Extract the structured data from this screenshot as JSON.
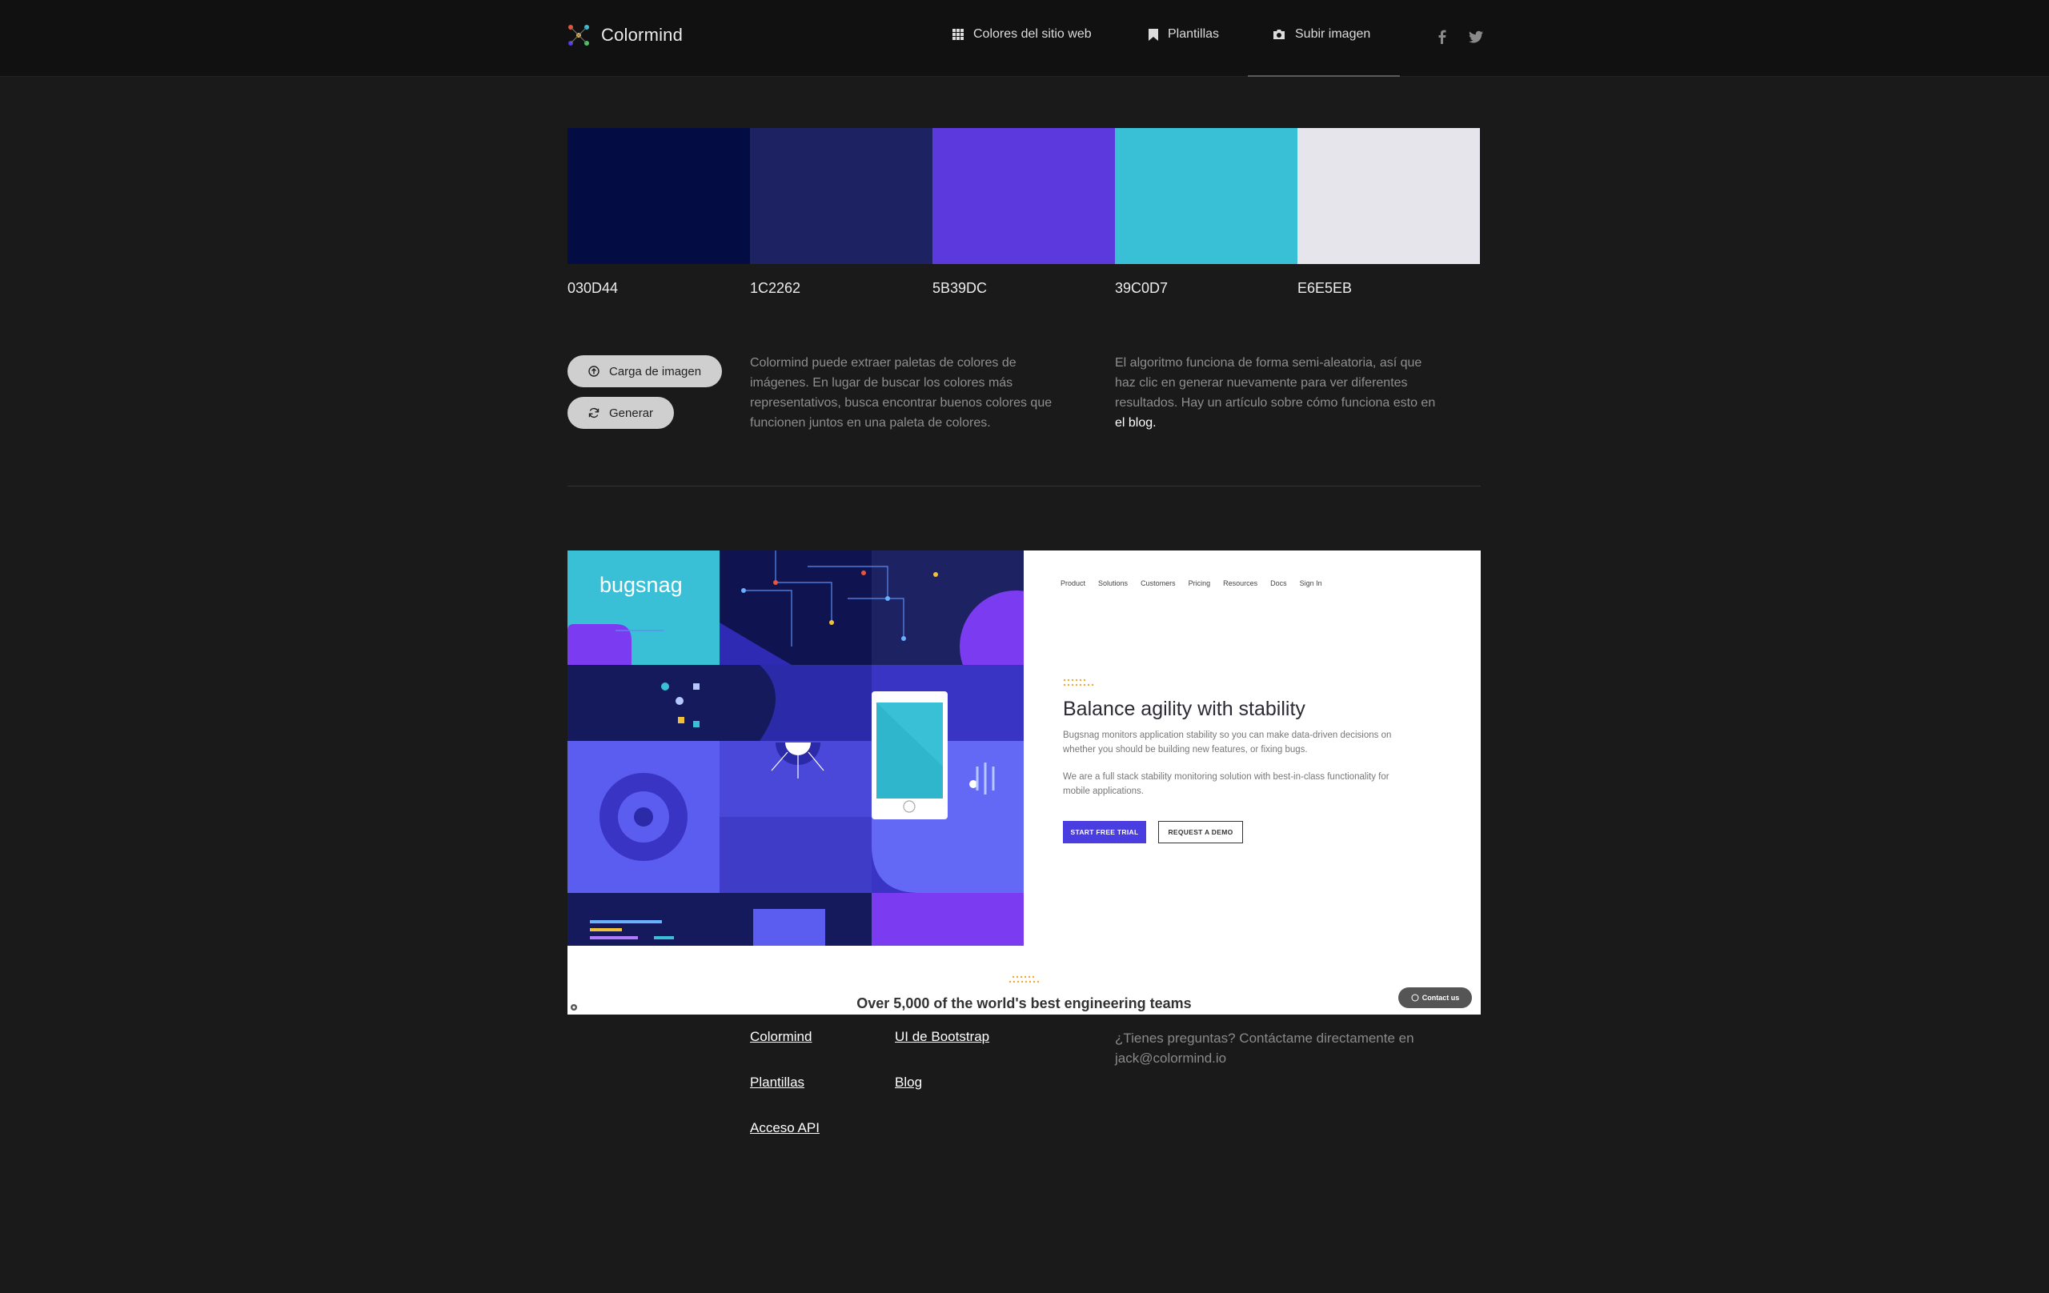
{
  "header": {
    "brand": "Colormind",
    "nav": {
      "website_colors": "Colores del sitio web",
      "templates": "Plantillas",
      "upload_image": "Subir imagen"
    }
  },
  "palette": {
    "colors": [
      {
        "hex": "030D44",
        "color": "#030D44"
      },
      {
        "hex": "1C2262",
        "color": "#1C2262"
      },
      {
        "hex": "5B39DC",
        "color": "#5B39DC"
      },
      {
        "hex": "39C0D7",
        "color": "#39C0D7"
      },
      {
        "hex": "E6E5EB",
        "color": "#E6E5EB"
      }
    ]
  },
  "actions": {
    "upload_label": "Carga de imagen",
    "generate_label": "Generar"
  },
  "info": {
    "left": "Colormind puede extraer paletas de colores de imágenes. En lugar de buscar los colores más representativos, busca encontrar buenos colores que funcionen juntos en una paleta de colores.",
    "right_prefix": "El algoritmo funciona de forma semi-aleatoria, así que haz clic en generar nuevamente para ver diferentes resultados. Hay un artículo sobre cómo funciona esto en",
    "right_link": "el blog."
  },
  "preview": {
    "logo": "bugsnag",
    "nav": [
      "Product",
      "Solutions",
      "Customers",
      "Pricing",
      "Resources",
      "Docs",
      "Sign In"
    ],
    "title": "Balance agility with stability",
    "para1": "Bugsnag monitors application stability so you can make data-driven decisions on whether you should be building new features, or fixing bugs.",
    "para2": "We are a full stack stability monitoring solution with best-in-class functionality for mobile applications.",
    "cta_primary": "START FREE TRIAL",
    "cta_secondary": "REQUEST A DEMO",
    "footer_title": "Over 5,000 of the world's best engineering teams",
    "contact": "Contact us"
  },
  "footer": {
    "col1": [
      "Colormind",
      "Plantillas",
      "Acceso API"
    ],
    "col2": [
      "UI de Bootstrap",
      "Blog"
    ],
    "contact": "¿Tienes preguntas? Contáctame directamente en jack@colormind.io"
  },
  "colors": {
    "page_bg": "#1a1a1a",
    "header_bg": "#111111",
    "button_bg": "#cfcfcf"
  }
}
